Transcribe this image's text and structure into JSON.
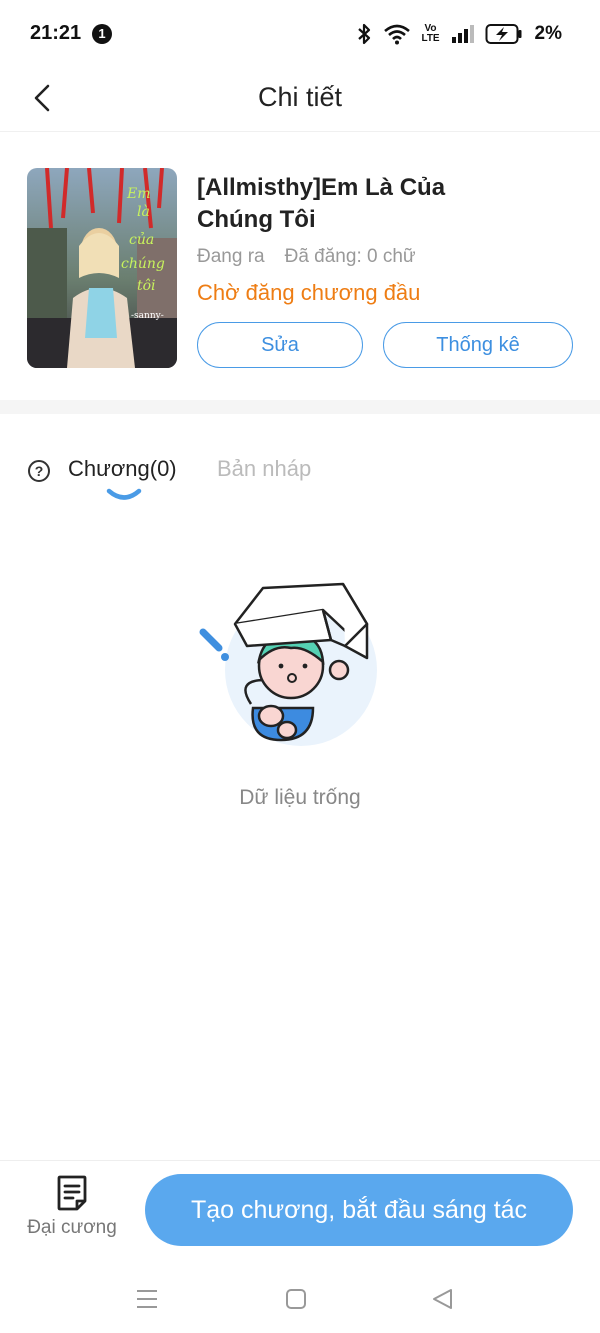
{
  "status_bar": {
    "time": "21:21",
    "notification_count": "1",
    "network_label": "Vo LTE",
    "battery_percent": "2%"
  },
  "header": {
    "title": "Chi tiết"
  },
  "book": {
    "title": "[Allmisthy]Em Là Của Chúng Tôi",
    "state": "Đang ra",
    "word_count": "Đã đăng: 0 chữ",
    "publish_status": "Chờ đăng chương đầu",
    "edit_label": "Sửa",
    "stats_label": "Thống kê",
    "cover_text": [
      "Em",
      "là",
      "của",
      "chúng",
      "tôi"
    ],
    "cover_credit": "-sanny-"
  },
  "tabs": {
    "chapters": "Chương(0)",
    "drafts": "Bản nháp"
  },
  "empty_state": {
    "text": "Dữ liệu trống"
  },
  "bottom_bar": {
    "outline_label": "Đại cương",
    "create_label": "Tạo chương, bắt đầu sáng tác"
  },
  "colors": {
    "accent_blue": "#5aa8ee",
    "status_orange": "#ee7d14"
  }
}
